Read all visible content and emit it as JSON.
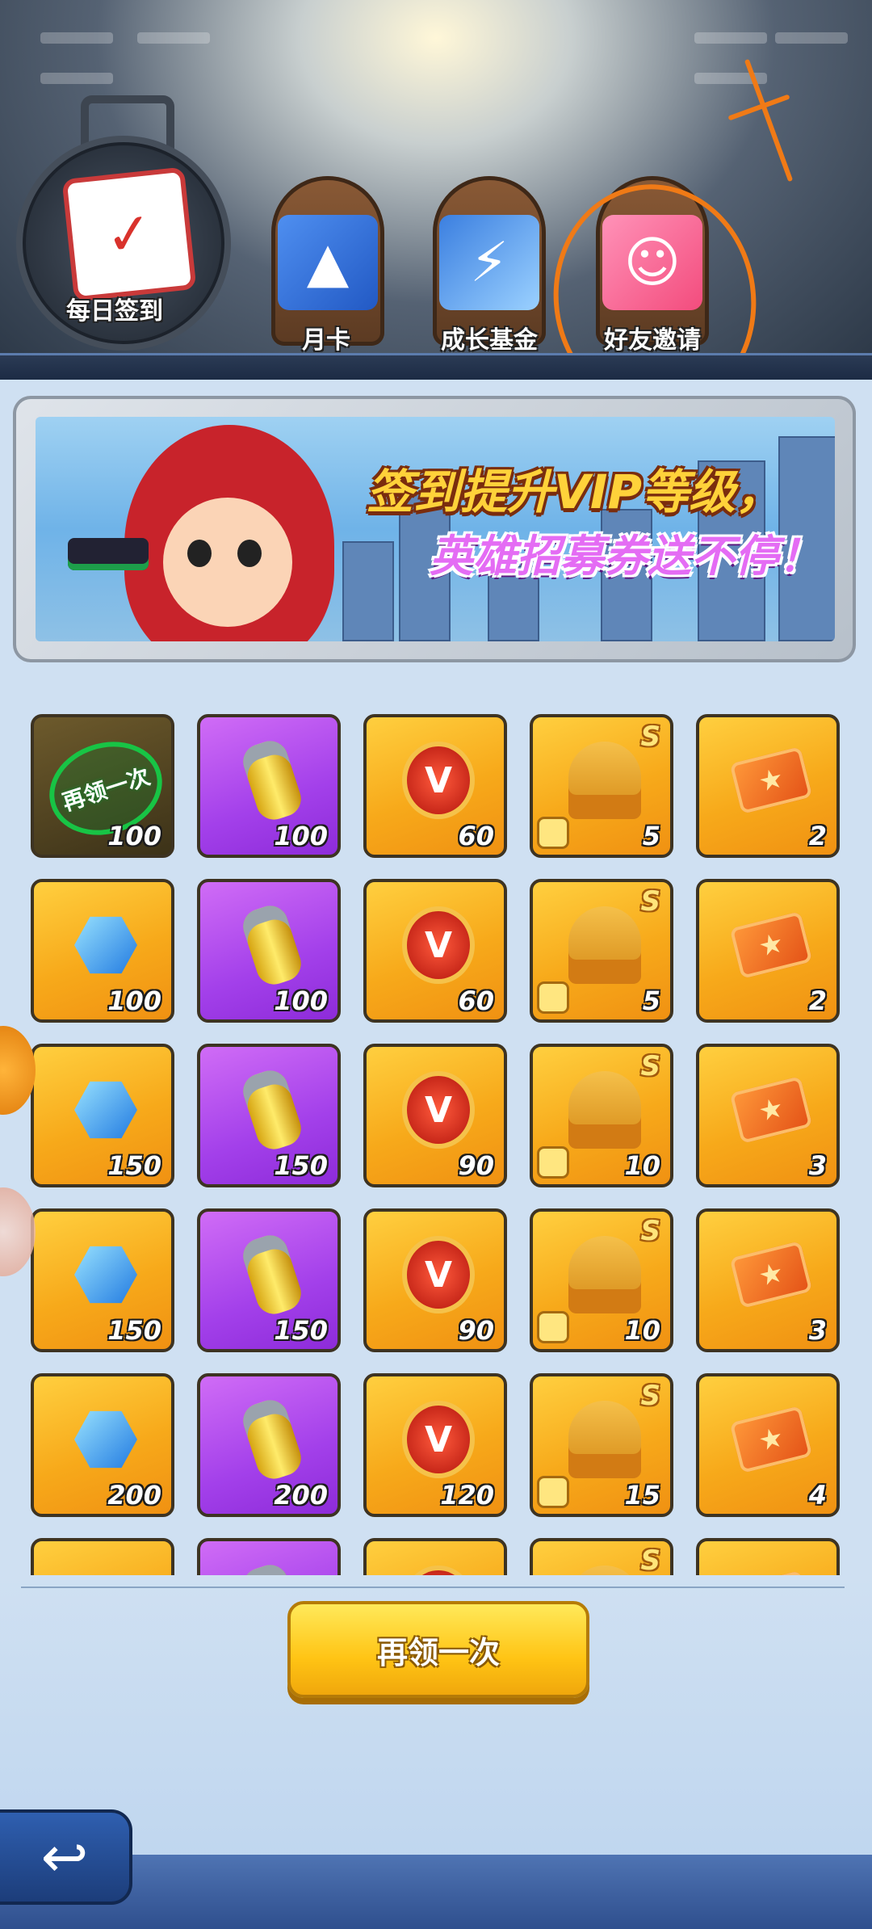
{
  "header": {
    "daily_sign_in": {
      "label": "每日签到",
      "icon": "calendar-icon"
    },
    "top_tabs": [
      {
        "label": "月卡",
        "icon": "card-icon"
      },
      {
        "label": "成长基金",
        "icon": "lightning-crystal-icon"
      },
      {
        "label": "好友邀请",
        "icon": "friends-icon"
      }
    ]
  },
  "banner": {
    "line1": "签到提升VIP等级，",
    "line2": "英雄招募券送不停！"
  },
  "rewards": {
    "claimed_stamp": "再领一次",
    "rows": [
      [
        {
          "type": "claimed",
          "qty": "100"
        },
        {
          "type": "capsule",
          "qty": "100"
        },
        {
          "type": "vip-badge",
          "qty": "60"
        },
        {
          "type": "soldier",
          "qty": "5",
          "rank": "S"
        },
        {
          "type": "ticket",
          "qty": "2"
        }
      ],
      [
        {
          "type": "gem",
          "qty": "100"
        },
        {
          "type": "capsule",
          "qty": "100"
        },
        {
          "type": "vip-badge",
          "qty": "60"
        },
        {
          "type": "soldier",
          "qty": "5",
          "rank": "S"
        },
        {
          "type": "ticket",
          "qty": "2"
        }
      ],
      [
        {
          "type": "gem",
          "qty": "150"
        },
        {
          "type": "capsule",
          "qty": "150"
        },
        {
          "type": "vip-badge",
          "qty": "90"
        },
        {
          "type": "soldier",
          "qty": "10",
          "rank": "S"
        },
        {
          "type": "ticket",
          "qty": "3"
        }
      ],
      [
        {
          "type": "gem",
          "qty": "150"
        },
        {
          "type": "capsule",
          "qty": "150"
        },
        {
          "type": "vip-badge",
          "qty": "90"
        },
        {
          "type": "soldier",
          "qty": "10",
          "rank": "S"
        },
        {
          "type": "ticket",
          "qty": "3"
        }
      ],
      [
        {
          "type": "gem",
          "qty": "200"
        },
        {
          "type": "capsule",
          "qty": "200"
        },
        {
          "type": "vip-badge",
          "qty": "120"
        },
        {
          "type": "soldier",
          "qty": "15",
          "rank": "S"
        },
        {
          "type": "ticket",
          "qty": "4"
        }
      ],
      [
        {
          "type": "gem",
          "qty": ""
        },
        {
          "type": "capsule",
          "qty": ""
        },
        {
          "type": "vip-badge",
          "qty": ""
        },
        {
          "type": "soldier",
          "qty": "",
          "rank": "S"
        },
        {
          "type": "ticket",
          "qty": ""
        }
      ]
    ]
  },
  "footer": {
    "claim_again_label": "再领一次",
    "back_icon": "back-arrow-icon"
  },
  "colors": {
    "gold_cell": "#f7a91a",
    "purple_cell": "#a340ea",
    "button_yellow": "#ffc414",
    "annotation": "#f07a16"
  }
}
